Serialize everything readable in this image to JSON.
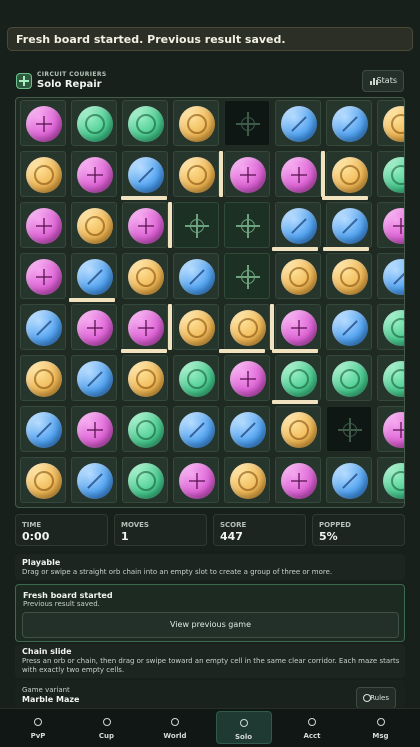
{
  "toast": {
    "message": "Fresh board started. Previous result saved."
  },
  "header": {
    "brand": "CIRCUIT COURIERS",
    "title": "Solo Repair",
    "stats_label": "Stats"
  },
  "board": {
    "rows": [
      [
        "pink-plus",
        "green-ring",
        "green-ring",
        "gold-ring",
        "empty",
        "blue-slash",
        "blue-slash",
        "gold-ring"
      ],
      [
        "gold-ring",
        "pink-plus",
        "blue-slash",
        "gold-ring",
        "pink-plus",
        "pink-plus",
        "gold-ring",
        "green-ring"
      ],
      [
        "pink-plus",
        "gold-ring",
        "pink-plus",
        "empty-lit",
        "empty-lit",
        "blue-slash",
        "blue-slash",
        "pink-plus"
      ],
      [
        "pink-plus",
        "blue-slash",
        "gold-ring",
        "blue-slash",
        "empty-lit",
        "gold-ring",
        "gold-ring",
        "blue-slash"
      ],
      [
        "blue-slash",
        "pink-plus",
        "pink-plus",
        "gold-ring",
        "gold-ring",
        "pink-plus",
        "blue-slash",
        "green-ring"
      ],
      [
        "gold-ring",
        "blue-slash",
        "gold-ring",
        "green-ring",
        "pink-plus",
        "green-ring",
        "green-ring",
        "green-ring"
      ],
      [
        "blue-slash",
        "pink-plus",
        "green-ring",
        "blue-slash",
        "blue-slash",
        "gold-ring",
        "empty",
        "pink-plus"
      ],
      [
        "gold-ring",
        "blue-slash",
        "green-ring",
        "pink-plus",
        "gold-ring",
        "pink-plus",
        "blue-slash",
        "green-ring"
      ]
    ]
  },
  "stats": [
    {
      "label": "TIME",
      "value": "0:00"
    },
    {
      "label": "MOVES",
      "value": "1"
    },
    {
      "label": "SCORE",
      "value": "447"
    },
    {
      "label": "POPPED",
      "value": "5%"
    }
  ],
  "playable": {
    "title": "Playable",
    "text": "Drag or swipe a straight orb chain into an empty slot to create a group of three or more."
  },
  "fresh": {
    "title": "Fresh board started",
    "text": "Previous result saved.",
    "button": "View previous game"
  },
  "chain": {
    "title": "Chain slide",
    "text": "Press an orb or chain, then drag or swipe toward an empty cell in the same clear corridor. Each maze starts with exactly two empty cells."
  },
  "variant": {
    "label": "Game variant",
    "value": "Marble Maze",
    "rules_label": "Rules"
  },
  "nav": [
    "PvP",
    "Cup",
    "World",
    "Solo",
    "Acct",
    "Msg"
  ],
  "nav_active": "Solo"
}
